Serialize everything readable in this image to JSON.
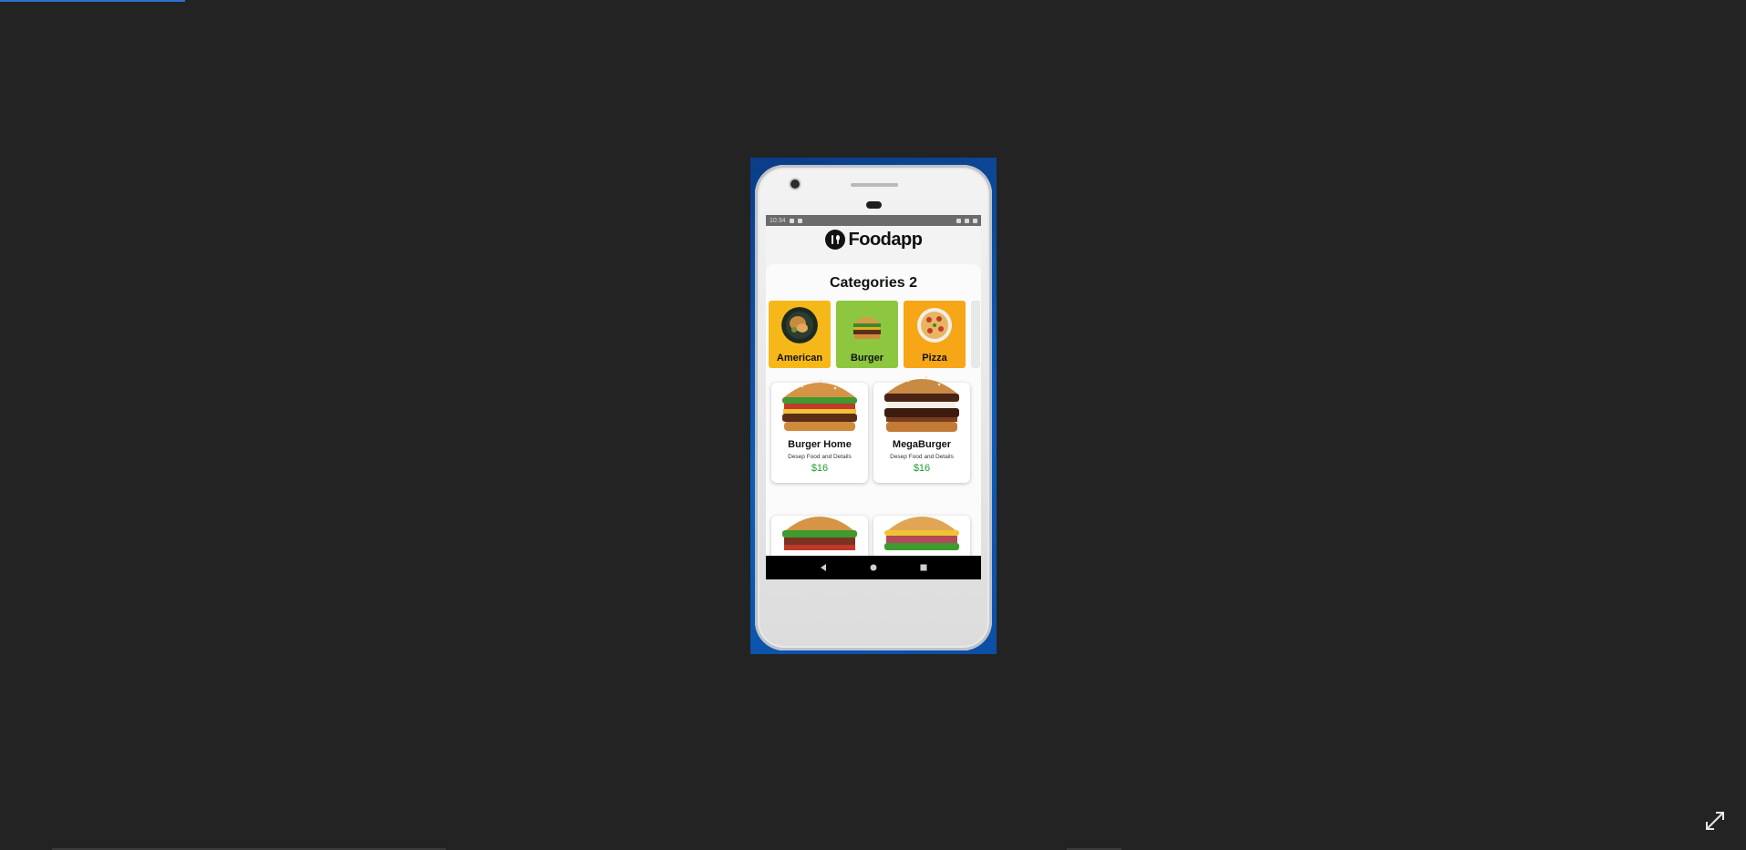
{
  "viewer": {
    "background": "#232323",
    "expand_icon": "expand-diagonal-icon"
  },
  "device": {
    "status_bar": {
      "time": "10:34"
    },
    "nav_bar": {
      "back_icon": "back-triangle-icon",
      "home_icon": "home-circle-icon",
      "recents_icon": "recents-square-icon"
    }
  },
  "app": {
    "logo_icon": "fork-spoon-icon",
    "logo_text": "Foodapp",
    "categories_title": "Categories 2",
    "categories": [
      {
        "label": "American",
        "color": "#f6b819",
        "icon": "chicken-plate-icon"
      },
      {
        "label": "Burger",
        "color": "#8dc63f",
        "icon": "burger-icon"
      },
      {
        "label": "Pizza",
        "color": "#f6a617",
        "icon": "pizza-icon"
      }
    ],
    "products": [
      {
        "name": "Burger Home",
        "desc": "Desep Food and Details",
        "price": "$16"
      },
      {
        "name": "MegaBurger",
        "desc": "Desep Food and Details",
        "price": "$16"
      },
      {
        "name": "",
        "desc": "",
        "price": ""
      },
      {
        "name": "",
        "desc": "",
        "price": ""
      }
    ],
    "price_color": "#1e9c2e"
  }
}
